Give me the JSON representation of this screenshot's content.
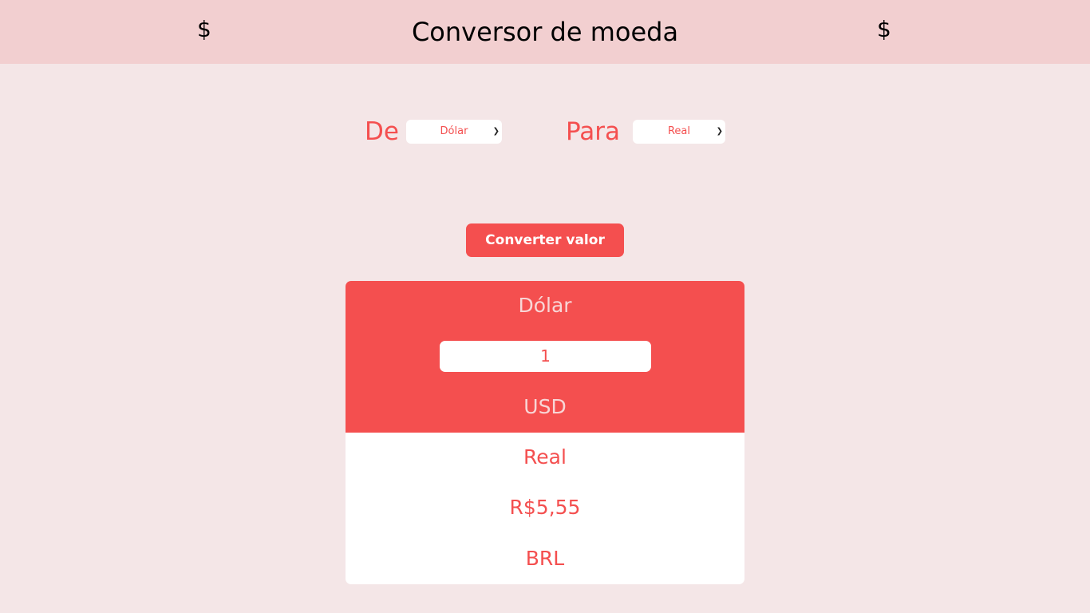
{
  "header": {
    "title": "Conversor de moeda",
    "left_symbol": "$",
    "right_symbol": "$"
  },
  "from": {
    "label": "De",
    "selected": "Dólar"
  },
  "to": {
    "label": "Para",
    "selected": "Real"
  },
  "convert_button": {
    "label": "Converter valor"
  },
  "source": {
    "currency_name": "Dólar",
    "amount_value": "1",
    "currency_code": "USD"
  },
  "result": {
    "currency_name": "Real",
    "amount": "R$5,55",
    "currency_code": "BRL"
  },
  "colors": {
    "accent": "#f44f4f",
    "header_bg": "#f2cfd0",
    "page_bg": "#f4e6e7"
  }
}
